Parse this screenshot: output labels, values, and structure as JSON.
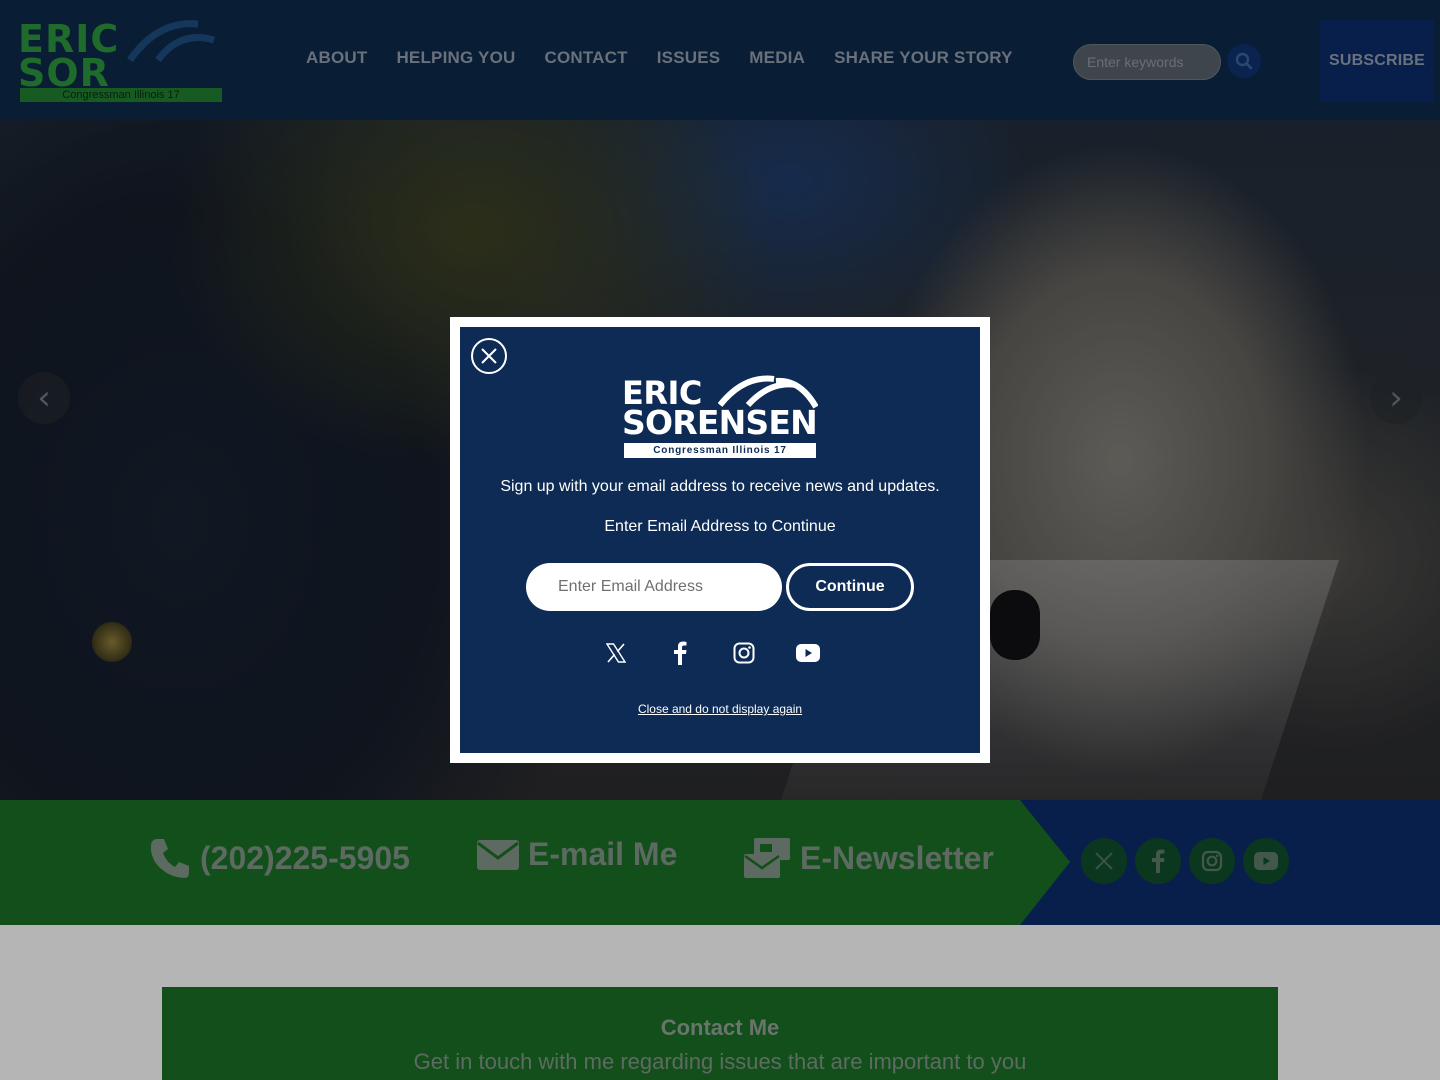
{
  "header": {
    "logo": {
      "line1": "ERIC",
      "line2": "SOR",
      "tagline": "Congressman Illinois 17"
    },
    "nav": [
      {
        "label": "ABOUT"
      },
      {
        "label": "HELPING YOU"
      },
      {
        "label": "CONTACT"
      },
      {
        "label": "ISSUES"
      },
      {
        "label": "MEDIA"
      },
      {
        "label": "SHARE YOUR STORY"
      }
    ],
    "search": {
      "placeholder": "Enter keywords",
      "icon": "search-icon"
    },
    "subscribe_label": "SUBSCRIBE"
  },
  "hero": {
    "prev_arrow": "‹",
    "next_arrow": "›"
  },
  "contact_bar": {
    "phone": {
      "label": "(202)225-5905",
      "icon": "phone-icon"
    },
    "email": {
      "label": "E-mail Me",
      "icon": "envelope-icon"
    },
    "newsletter": {
      "label": "E-Newsletter",
      "icon": "newsletter-icon"
    },
    "social": [
      {
        "name": "x",
        "icon": "x-icon"
      },
      {
        "name": "facebook",
        "icon": "facebook-icon"
      },
      {
        "name": "instagram",
        "icon": "instagram-icon"
      },
      {
        "name": "youtube",
        "icon": "youtube-icon"
      }
    ]
  },
  "contact_section": {
    "title": "Contact Me",
    "subtitle": "Get in touch with me regarding issues that are important to you"
  },
  "modal": {
    "logo": {
      "line1": "ERIC",
      "line2": "SORENSEN",
      "tagline": "Congressman Illinois 17"
    },
    "signup_text": "Sign up with your email address to receive news and updates.",
    "prompt_text": "Enter Email Address to Continue",
    "email_placeholder": "Enter Email Address",
    "continue_label": "Continue",
    "dismiss_label": "Close and do not display again",
    "social": [
      {
        "name": "x",
        "icon": "x-icon"
      },
      {
        "name": "facebook",
        "icon": "facebook-icon"
      },
      {
        "name": "instagram",
        "icon": "instagram-icon"
      },
      {
        "name": "youtube",
        "icon": "youtube-icon"
      }
    ]
  },
  "colors": {
    "header_bg": "#0d2747",
    "modal_bg": "#0d2b54",
    "green_bar": "#1a6a25",
    "blue_bar": "#0b2a66"
  }
}
